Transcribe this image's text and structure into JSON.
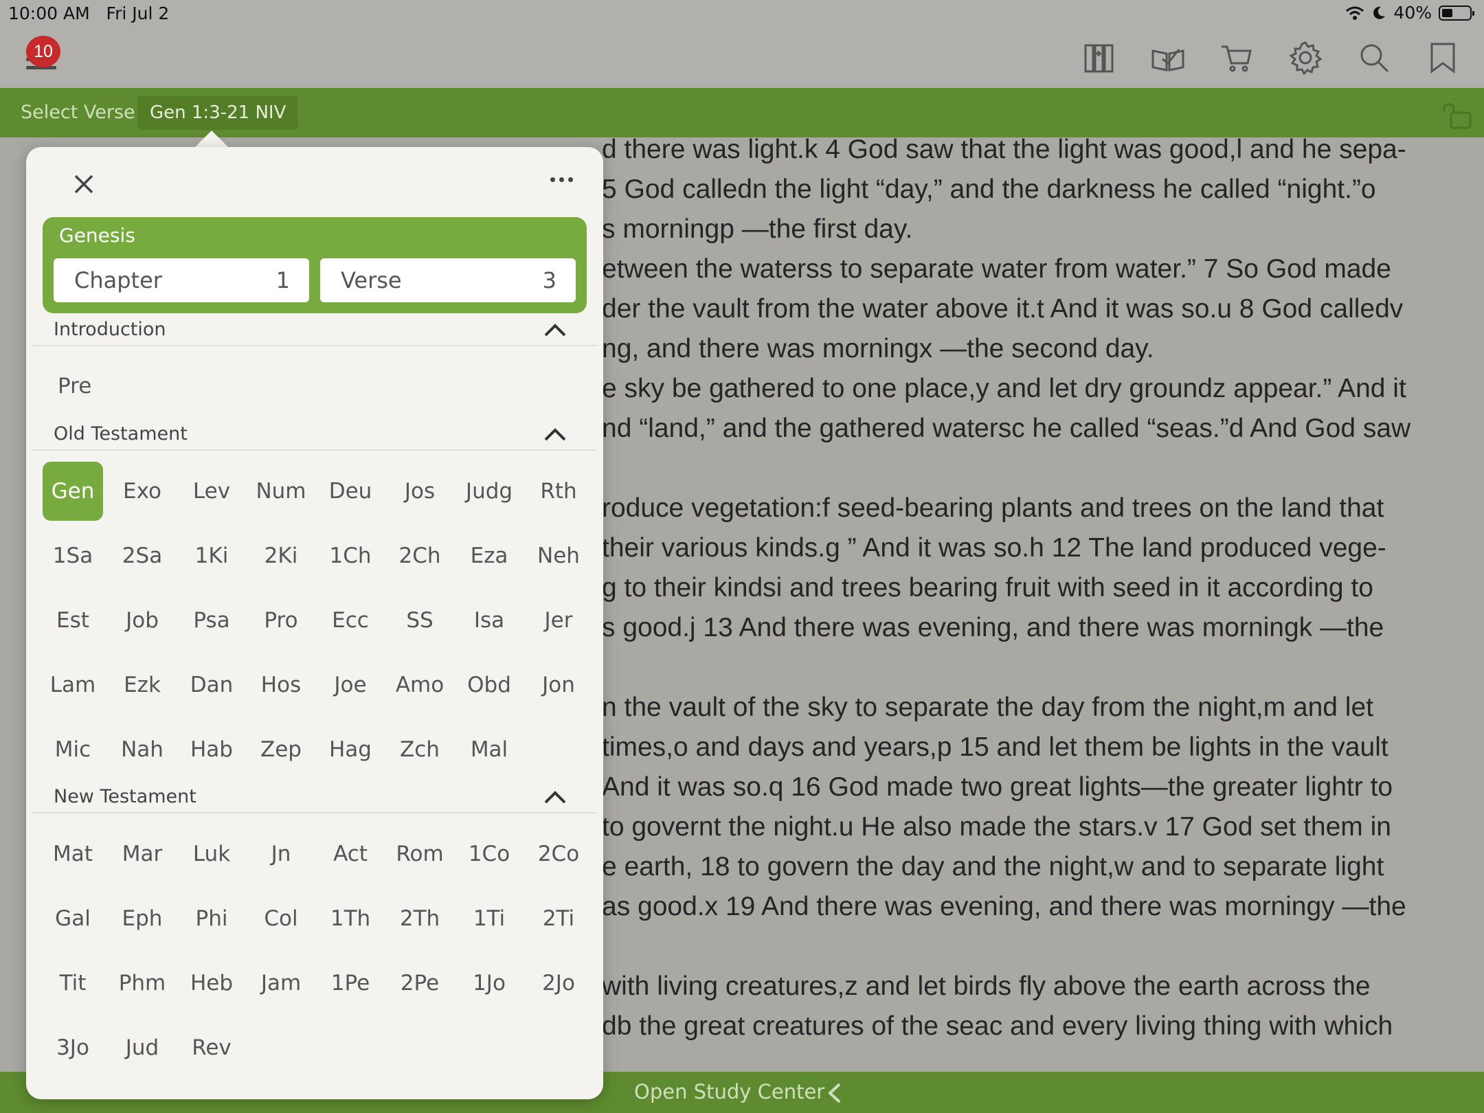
{
  "status": {
    "time": "10:00 AM",
    "date": "Fri Jul 2",
    "battery_text": "40%",
    "battery_level": 0.4
  },
  "menu": {
    "badge_count": "10"
  },
  "verse_bar": {
    "select_label": "Select Verse",
    "reference": "Gen 1:3-21 NIV"
  },
  "bottom_bar": {
    "label": "Open Study Center"
  },
  "popover": {
    "book_name": "Genesis",
    "chapter_label": "Chapter",
    "chapter_value": "1",
    "verse_label": "Verse",
    "verse_value": "3",
    "sections": {
      "intro": "Introduction",
      "ot": "Old Testament",
      "nt": "New Testament"
    },
    "intro_items": [
      "Pre"
    ],
    "ot_books": [
      "Gen",
      "Exo",
      "Lev",
      "Num",
      "Deu",
      "Jos",
      "Judg",
      "Rth",
      "1Sa",
      "2Sa",
      "1Ki",
      "2Ki",
      "1Ch",
      "2Ch",
      "Eza",
      "Neh",
      "Est",
      "Job",
      "Psa",
      "Pro",
      "Ecc",
      "SS",
      "Isa",
      "Jer",
      "Lam",
      "Ezk",
      "Dan",
      "Hos",
      "Joe",
      "Amo",
      "Obd",
      "Jon",
      "Mic",
      "Nah",
      "Hab",
      "Zep",
      "Hag",
      "Zch",
      "Mal"
    ],
    "nt_books": [
      "Mat",
      "Mar",
      "Luk",
      "Jn",
      "Act",
      "Rom",
      "1Co",
      "2Co",
      "Gal",
      "Eph",
      "Phi",
      "Col",
      "1Th",
      "2Th",
      "1Ti",
      "2Ti",
      "Tit",
      "Phm",
      "Heb",
      "Jam",
      "1Pe",
      "2Pe",
      "1Jo",
      "2Jo",
      "3Jo",
      "Jud",
      "Rev"
    ],
    "selected_book": "Gen"
  },
  "text_lines": [
    "d there was light.k 4 God saw that the light was good,l and he sepa-",
    "5 God calledn the light “day,” and the darkness he called “night.”o",
    "s morningp —the first day.",
    "etween the waterss to separate water from water.” 7 So God made",
    "der the vault from the water above it.t And it was so.u 8 God calledv",
    "ng, and there was morningx —the second day.",
    "e sky be gathered to one place,y and let dry groundz appear.” And it",
    "nd “land,” and the gathered watersc he called “seas.”d And God saw",
    "",
    "roduce vegetation:f seed-bearing plants and trees on the land that",
    "their various kinds.g ” And it was so.h 12 The land produced vege-",
    "g to their kindsi and trees bearing fruit with seed in it according to",
    "s good.j 13 And there was evening, and there was morningk —the",
    "",
    "n the vault of the sky to separate the day from the night,m and let",
    "times,o and days and years,p 15 and let them be lights in the vault",
    "And it was so.q 16 God made two great lights—the greater lightr to",
    "to governt the night.u He also made the stars.v 17 God set them in",
    "e earth, 18 to govern the day and the night,w and to separate light",
    "as good.x 19 And there was evening, and there was morningy —the",
    "",
    "with living creatures,z and let birds fly above the earth across the",
    "db the great creatures of the seac and every living thing with which"
  ]
}
